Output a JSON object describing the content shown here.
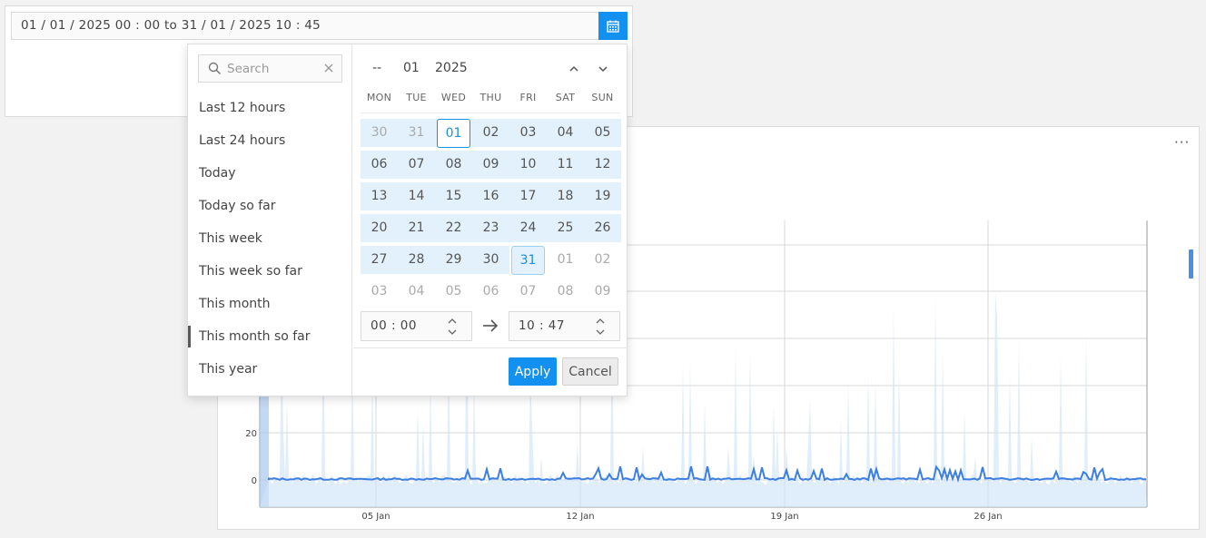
{
  "range_input": {
    "value": "01 / 01 / 2025  00 : 00  to  31 / 01 / 2025  10 : 45"
  },
  "calendar_button": {
    "icon": "calendar-icon"
  },
  "search": {
    "placeholder": "Search"
  },
  "presets": [
    {
      "label": "Last 12 hours",
      "active": false
    },
    {
      "label": "Last 24 hours",
      "active": false
    },
    {
      "label": "Today",
      "active": false
    },
    {
      "label": "Today so far",
      "active": false
    },
    {
      "label": "This week",
      "active": false
    },
    {
      "label": "This week so far",
      "active": false
    },
    {
      "label": "This month",
      "active": false
    },
    {
      "label": "This month so far",
      "active": true
    },
    {
      "label": "This year",
      "active": false
    }
  ],
  "calendar": {
    "month_placeholder": "--",
    "month": "01",
    "year": "2025",
    "weekdays": [
      "MON",
      "TUE",
      "WED",
      "THU",
      "FRI",
      "SAT",
      "SUN"
    ],
    "weeks": [
      [
        "30",
        "31",
        "01",
        "02",
        "03",
        "04",
        "05"
      ],
      [
        "06",
        "07",
        "08",
        "09",
        "10",
        "11",
        "12"
      ],
      [
        "13",
        "14",
        "15",
        "16",
        "17",
        "18",
        "19"
      ],
      [
        "20",
        "21",
        "22",
        "23",
        "24",
        "25",
        "26"
      ],
      [
        "27",
        "28",
        "29",
        "30",
        "31",
        "01",
        "02"
      ],
      [
        "03",
        "04",
        "05",
        "06",
        "07",
        "08",
        "09"
      ]
    ],
    "range_start": "01",
    "range_end": "31"
  },
  "time": {
    "from": "00 : 00",
    "to": "10 : 47"
  },
  "buttons": {
    "apply": "Apply",
    "cancel": "Cancel"
  },
  "chart_data": {
    "type": "line",
    "title": "",
    "x_ticks": [
      "05 Jan",
      "12 Jan",
      "19 Jan",
      "26 Jan"
    ],
    "y_ticks_visible": [
      0,
      20
    ],
    "series": [
      {
        "color": "#3d7fe0"
      },
      {
        "color": "#cfe3f7"
      }
    ],
    "grid": true
  },
  "colors": {
    "accent": "#1391f0",
    "range_bg": "#e2f1fb",
    "line": "#3d7fe0",
    "area": "#cfe3f7"
  }
}
